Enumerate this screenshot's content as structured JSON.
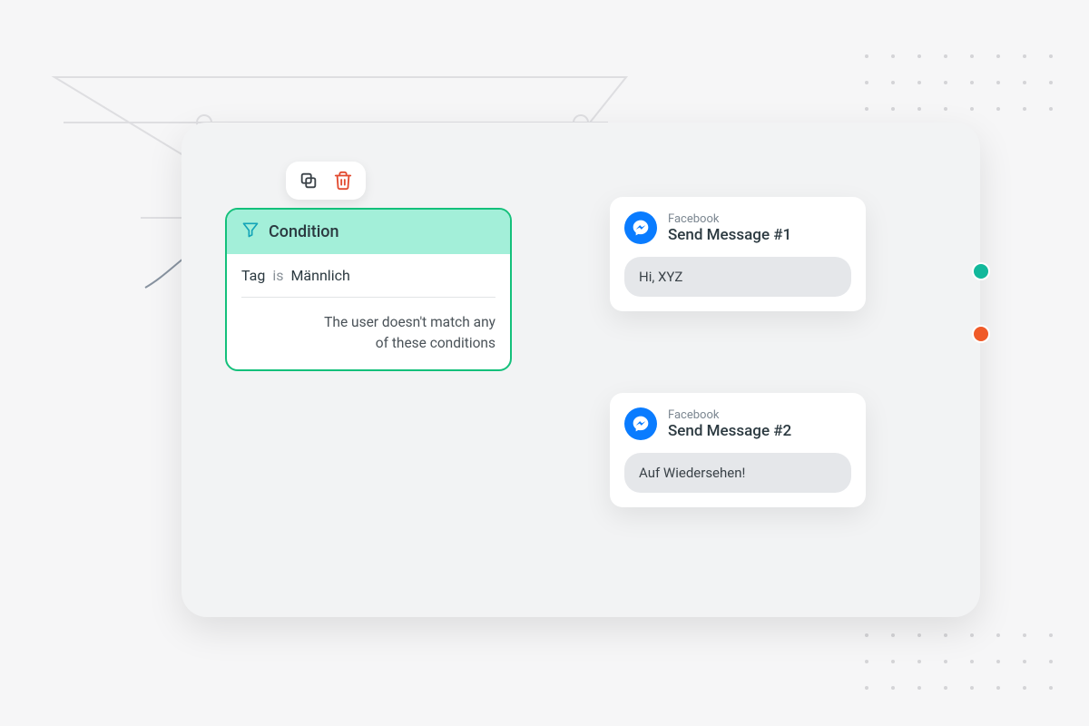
{
  "condition": {
    "header_label": "Condition",
    "rule_subject": "Tag",
    "rule_op": "is",
    "rule_value": "Männlich",
    "else_line1": "The user doesn't match any",
    "else_line2": "of these conditions"
  },
  "messages": [
    {
      "channel": "Facebook",
      "title": "Send Message #1",
      "body": "Hi, XYZ"
    },
    {
      "channel": "Facebook",
      "title": "Send Message #2",
      "body": "Auf Wiedersehen!"
    }
  ],
  "colors": {
    "yes": "#12b89b",
    "no": "#f05a28",
    "condition_border": "#14c07b",
    "fb_blue": "#0a7cff"
  }
}
